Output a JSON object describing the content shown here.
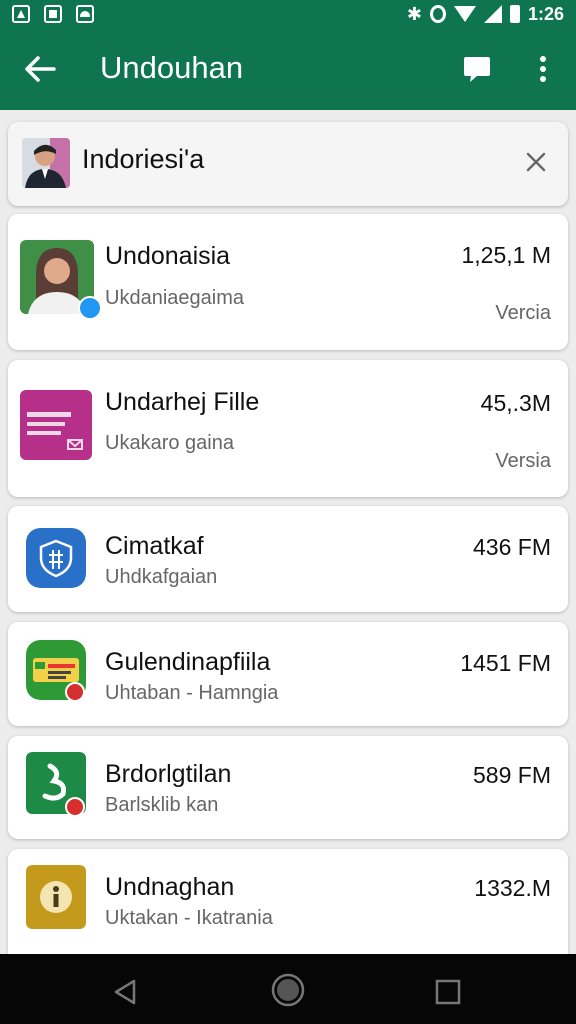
{
  "status_bar": {
    "time": "1:26",
    "left_icons": [
      "drive-icon",
      "image-icon",
      "photo-icon"
    ],
    "right_icons": [
      "bluetooth-icon",
      "data-saver-icon",
      "wifi-icon",
      "signal-icon",
      "battery-icon"
    ]
  },
  "app_bar": {
    "title": "Undouhan",
    "back_icon": "arrow-back-icon",
    "chat_icon": "chat-bubble-icon",
    "more_icon": "more-vert-icon"
  },
  "search": {
    "value": "Indoriesi'a",
    "clear_icon": "close-icon"
  },
  "downloads": [
    {
      "title": "Undonaisia",
      "subtitle": "Ukdaniaegaima",
      "size": "1,25,1 M",
      "version": "Vercia",
      "icon": "profile-photo-icon",
      "badge": "blue"
    },
    {
      "title": "Undarhej Fille",
      "subtitle": "Ukakaro gaina",
      "size": "45,.3M",
      "version": "Versia",
      "icon": "document-icon",
      "badge": ""
    },
    {
      "title": "Cimatkaf",
      "subtitle": "Uhdkafgaian",
      "size": "436 FM",
      "version": "",
      "icon": "shield-icon",
      "badge": ""
    },
    {
      "title": "Gulendinapfiila",
      "subtitle": "Uhtaban - Hamngia",
      "size": "1451 FM",
      "version": "",
      "icon": "id-card-icon",
      "badge": "red"
    },
    {
      "title": "Brdorlgtilan",
      "subtitle": "Barlsklib kan",
      "size": "589 FM",
      "version": "",
      "icon": "leaf-icon",
      "badge": "red"
    },
    {
      "title": "Undnaghan",
      "subtitle": "Uktakan - Ikatrania",
      "size": "1332.M",
      "version": "",
      "icon": "info-icon",
      "badge": ""
    }
  ],
  "nav": {
    "back_icon": "nav-back-icon",
    "home_icon": "nav-home-icon",
    "recents_icon": "nav-recents-icon"
  },
  "colors": {
    "primary": "#0e7550",
    "background": "#ececec",
    "card": "#ffffff",
    "nav_bar": "#060606"
  }
}
